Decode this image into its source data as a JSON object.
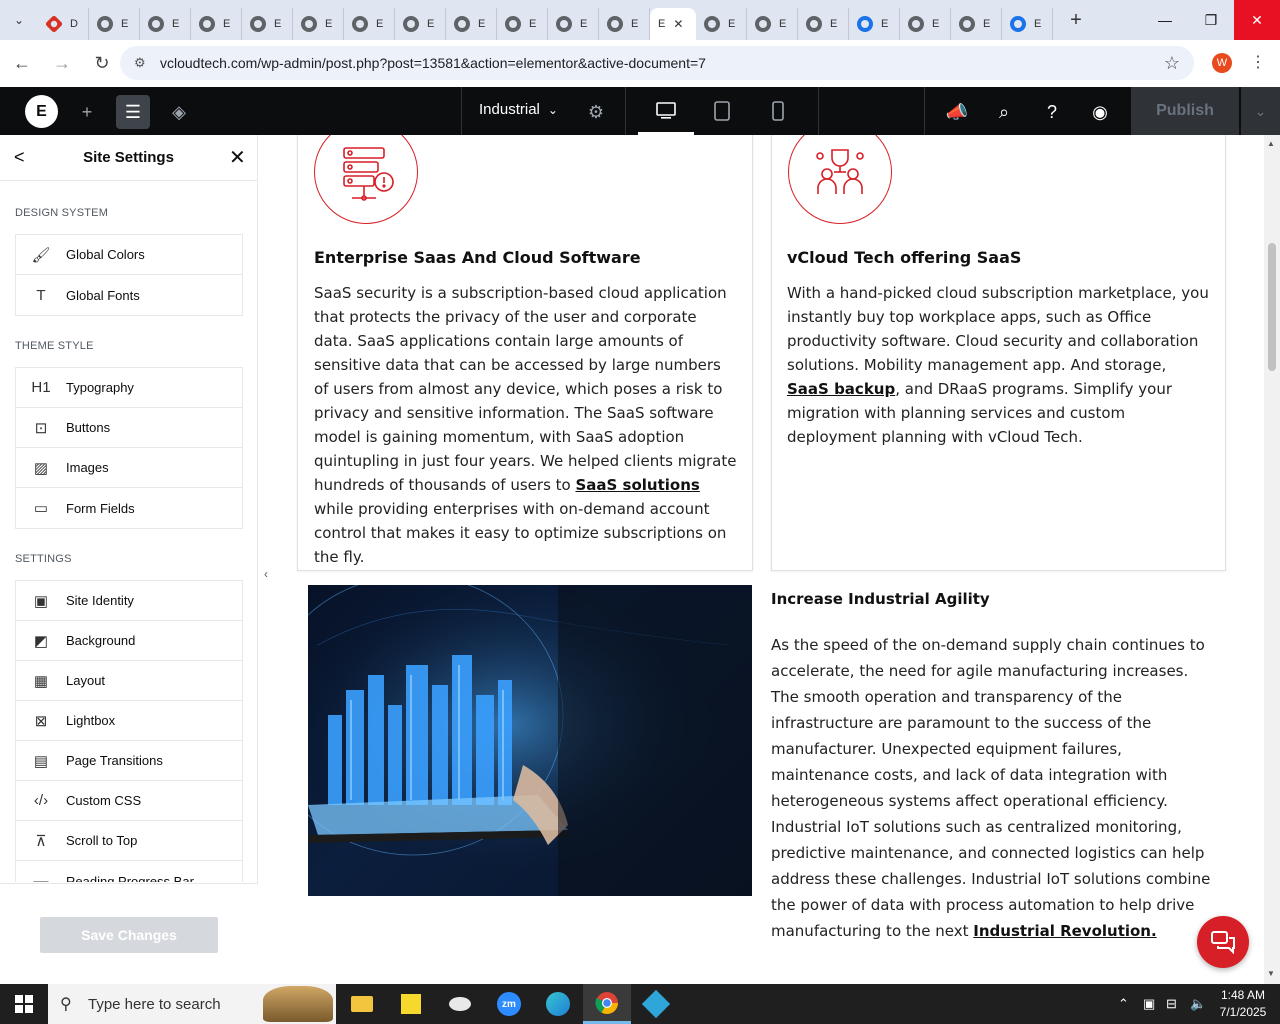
{
  "browser": {
    "tabs": [
      {
        "label": "D",
        "icon": "red-diamond-favicon"
      },
      {
        "label": "E",
        "icon": "globe-favicon"
      },
      {
        "label": "E",
        "icon": "globe-favicon"
      },
      {
        "label": "E",
        "icon": "globe-favicon"
      },
      {
        "label": "E",
        "icon": "globe-favicon"
      },
      {
        "label": "E",
        "icon": "globe-favicon"
      },
      {
        "label": "E",
        "icon": "globe-favicon"
      },
      {
        "label": "E",
        "icon": "globe-favicon"
      },
      {
        "label": "E",
        "icon": "globe-favicon"
      },
      {
        "label": "E",
        "icon": "globe-favicon"
      },
      {
        "label": "E",
        "icon": "globe-favicon"
      },
      {
        "label": "E",
        "icon": "globe-favicon"
      },
      {
        "label": "E",
        "icon": "elementor-favicon",
        "active": true
      },
      {
        "label": "E",
        "icon": "globe-favicon"
      },
      {
        "label": "E",
        "icon": "globe-favicon"
      },
      {
        "label": "E",
        "icon": "globe-favicon"
      },
      {
        "label": "E",
        "icon": "blue-swirl-favicon"
      },
      {
        "label": "E",
        "icon": "globe-favicon"
      },
      {
        "label": "E",
        "icon": "settings-favicon"
      },
      {
        "label": "E",
        "icon": "blue-eye-favicon"
      }
    ],
    "active_tab_close": "✕",
    "new_tab": "+",
    "url": "vcloudtech.com/wp-admin/post.php?post=13581&action=elementor&active-document=7",
    "profile_initial": "W"
  },
  "elementor": {
    "page_name": "Industrial",
    "publish_label": "Publish"
  },
  "panel": {
    "title": "Site Settings",
    "sections": {
      "design_system": "DESIGN SYSTEM",
      "theme_style": "THEME STYLE",
      "settings": "SETTINGS"
    },
    "design_items": [
      "Global Colors",
      "Global Fonts"
    ],
    "theme_items": [
      "Typography",
      "Buttons",
      "Images",
      "Form Fields"
    ],
    "settings_items": [
      "Site Identity",
      "Background",
      "Layout",
      "Lightbox",
      "Page Transitions",
      "Custom CSS",
      "Scroll to Top",
      "Reading Progress Bar"
    ],
    "save_label": "Save Changes"
  },
  "content": {
    "card1": {
      "title": "Enterprise Saas And Cloud Software",
      "body_before": "SaaS security is a subscription-based cloud application that protects the privacy of the user and corporate data. SaaS applications contain large amounts of sensitive data that can be accessed by large numbers of users from almost any device, which poses a risk to privacy and sensitive information. The SaaS software model is gaining momentum, with SaaS adoption quintupling in just four years. We helped clients migrate hundreds of thousands of users to ",
      "link": "SaaS solutions",
      "body_after": " while providing enterprises with on-demand account control that makes it easy to optimize subscriptions on the fly."
    },
    "card2": {
      "title": "vCloud Tech offering SaaS",
      "body_before": "With a hand-picked cloud subscription marketplace, you instantly buy top workplace apps, such as Office productivity software. Cloud security and collaboration solutions. Mobility management app. And storage, ",
      "link": "SaaS backup",
      "body_after": ", and DRaaS programs. Simplify your migration with planning services and custom deployment planning with vCloud Tech."
    },
    "section": {
      "title": "Increase Industrial Agility",
      "body_before": "As the speed of the on-demand supply chain continues to accelerate, the need for agile manufacturing increases. The smooth operation and transparency of the infrastructure are paramount to the success of the manufacturer. Unexpected equipment failures, maintenance costs, and lack of data integration with heterogeneous systems affect operational efficiency. Industrial IoT solutions such as centralized monitoring, predictive maintenance, and connected logistics can help address these challenges. Industrial IoT solutions combine the power of data with process automation to help drive manufacturing to the next ",
      "link": "Industrial Revolution."
    }
  },
  "taskbar": {
    "search_placeholder": "Type here to search",
    "time": "1:48 AM",
    "date": "7/1/2025"
  },
  "colors": {
    "brand_red": "#d61f26",
    "elementor_dark": "#0c0d0e",
    "chrome_tabstrip": "#dfe6f1"
  }
}
